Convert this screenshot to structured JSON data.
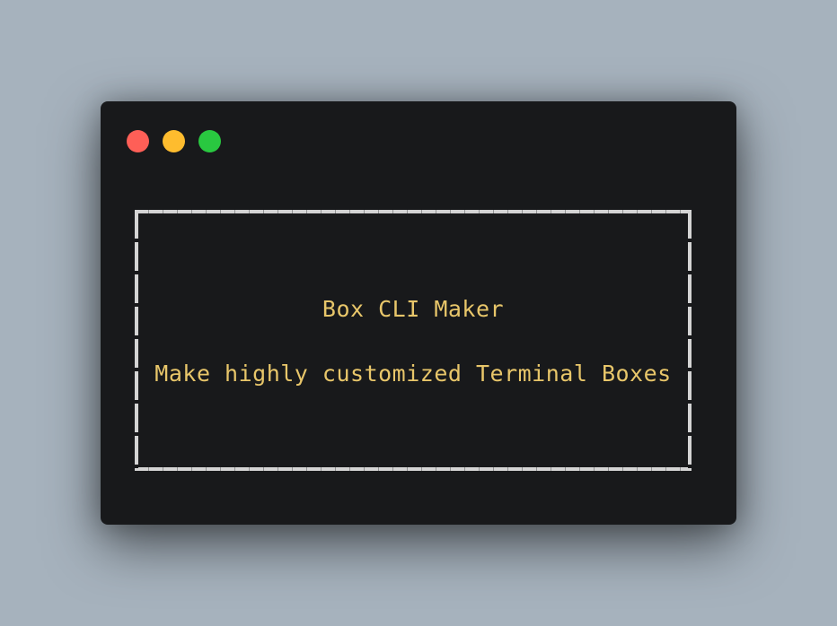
{
  "window": {
    "controls": [
      {
        "name": "close",
        "color": "#fe5f57"
      },
      {
        "name": "minimize",
        "color": "#febc2e"
      },
      {
        "name": "maximize",
        "color": "#29c840"
      }
    ]
  },
  "terminal_box": {
    "title": "Box CLI Maker",
    "content": "Make highly customized Terminal Boxes",
    "text_color": "#e8c66a",
    "border_color": "#d4d4d4"
  },
  "colors": {
    "background": "#a6b2bd",
    "window": "#18191b"
  }
}
